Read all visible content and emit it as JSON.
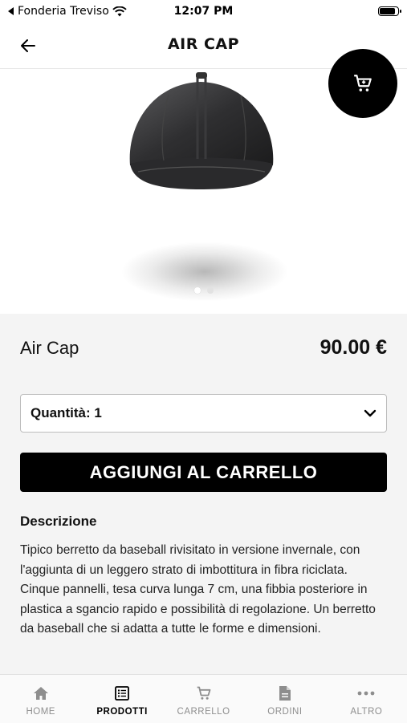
{
  "status_bar": {
    "back_app": "Fonderia Treviso",
    "time": "12:07 PM",
    "battery_level": 0.9
  },
  "nav": {
    "title": "AIR CAP",
    "back_icon": "arrow-left-icon"
  },
  "cart_fab": {
    "icon": "shopping-cart-icon"
  },
  "gallery": {
    "image": "black-baseball-cap",
    "pages": 2,
    "current_page": 1
  },
  "product": {
    "name": "Air Cap",
    "price": "90.00 €",
    "quantity_label": "Quantità: 1",
    "add_to_cart": "AGGIUNGI AL CARRELLO",
    "description_title": "Descrizione",
    "description": "Tipico berretto da baseball rivisitato in versione invernale, con l'aggiunta di un leggero strato di imbottitura in fibra riciclata. Cinque pannelli, tesa curva lunga 7 cm, una fibbia posteriore in plastica a sgancio rapido e possibilità di regolazione. Un berretto da baseball che si adatta a tutte le forme e dimensioni."
  },
  "tabs": [
    {
      "label": "HOME",
      "icon": "home-icon",
      "active": false
    },
    {
      "label": "PRODOTTI",
      "icon": "list-icon",
      "active": true
    },
    {
      "label": "CARRELLO",
      "icon": "cart-icon",
      "active": false
    },
    {
      "label": "ORDINI",
      "icon": "document-icon",
      "active": false
    },
    {
      "label": "ALTRO",
      "icon": "more-icon",
      "active": false
    }
  ],
  "colors": {
    "primary": "#000000",
    "background": "#f4f4f4",
    "inactive_tab": "#8e8e8e"
  }
}
